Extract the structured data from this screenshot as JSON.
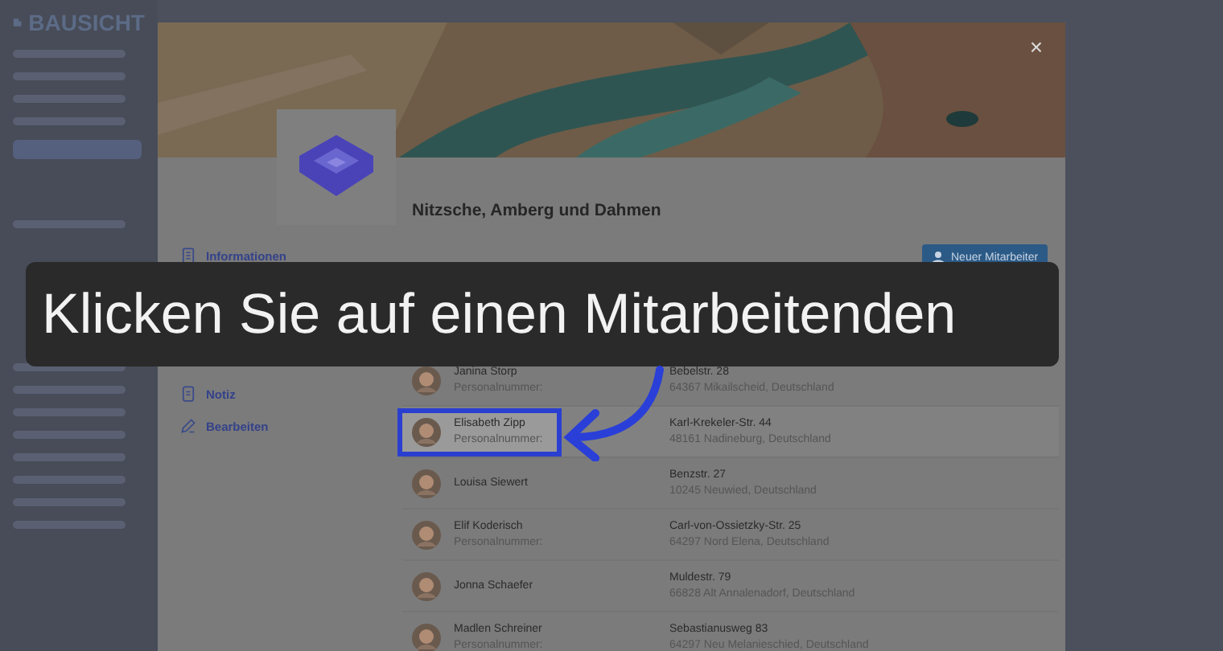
{
  "app": {
    "brand": "BAUSICHT"
  },
  "sidebar": {
    "items": [
      {
        "selected": false
      },
      {
        "selected": false
      },
      {
        "selected": false
      },
      {
        "selected": false
      },
      {
        "selected": true
      },
      {
        "selected": false
      },
      {
        "selected": false
      },
      {
        "selected": false
      },
      {
        "selected": false
      },
      {
        "selected": false
      },
      {
        "selected": false
      },
      {
        "selected": false
      },
      {
        "selected": false
      },
      {
        "selected": false
      }
    ]
  },
  "modal": {
    "close": "×",
    "company": "Nitzsche, Amberg und Dahmen",
    "nav": [
      {
        "label": "Informationen",
        "kind": "doc"
      },
      {
        "label": "Notiz",
        "kind": "note"
      },
      {
        "label": "Bearbeiten",
        "kind": "edit"
      }
    ],
    "new_button": "Neuer Mitarbeiter",
    "rows": [
      {
        "name": "Janina Storp",
        "sub": "Personalnummer:",
        "street": "Bebelstr. 28",
        "city": "64367 Mikailscheid, Deutschland",
        "selected": false
      },
      {
        "name": "Elisabeth Zipp",
        "sub": "Personalnummer:",
        "street": "Karl-Krekeler-Str. 44",
        "city": "48161 Nadineburg, Deutschland",
        "selected": true
      },
      {
        "name": "Louisa Siewert",
        "street": "Benzstr. 27",
        "city": "10245 Neuwied, Deutschland",
        "selected": false
      },
      {
        "name": "Elif Koderisch",
        "sub": "Personalnummer:",
        "street": "Carl-von-Ossietzky-Str. 25",
        "city": "64297 Nord Elena, Deutschland",
        "selected": false
      },
      {
        "name": "Jonna Schaefer",
        "street": "Muldestr. 79",
        "city": "66828 Alt Annalenadorf, Deutschland",
        "selected": false
      },
      {
        "name": "Madlen Schreiner",
        "sub": "Personalnummer:",
        "street": "Sebastianusweg 83",
        "city": "64297 Neu Melanieschied, Deutschland",
        "selected": false
      }
    ]
  },
  "caption": "Klicken Sie auf einen Mitarbeitenden"
}
